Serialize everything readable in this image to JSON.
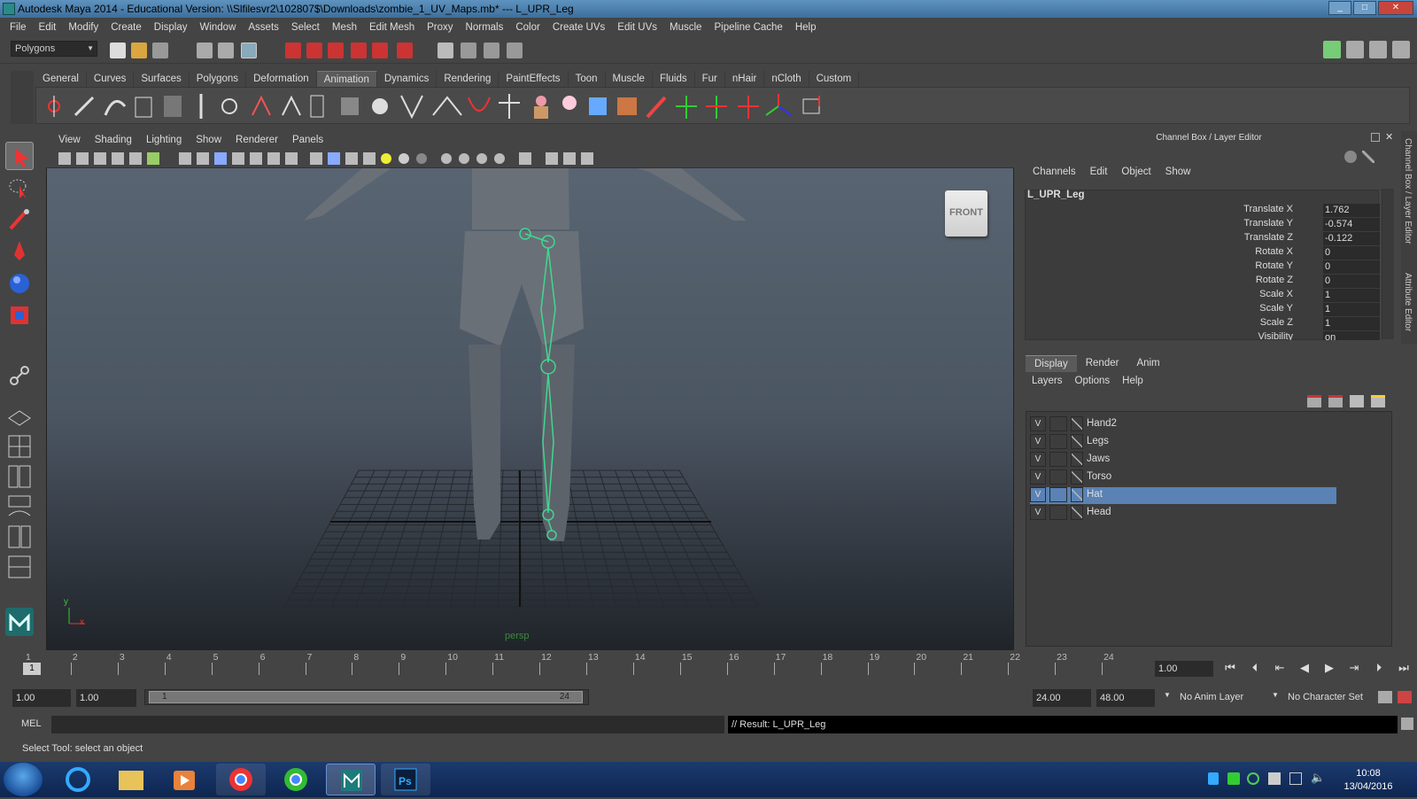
{
  "window": {
    "title": "Autodesk Maya 2014 - Educational Version: \\\\Slfilesvr2\\102807$\\Downloads\\zombie_1_UV_Maps.mb*   ---   L_UPR_Leg"
  },
  "menubar": [
    "File",
    "Edit",
    "Modify",
    "Create",
    "Display",
    "Window",
    "Assets",
    "Select",
    "Mesh",
    "Edit Mesh",
    "Proxy",
    "Normals",
    "Color",
    "Create UVs",
    "Edit UVs",
    "Muscle",
    "Pipeline Cache",
    "Help"
  ],
  "toolbar": {
    "mode": "Polygons"
  },
  "shelf": {
    "tabs": [
      "General",
      "Curves",
      "Surfaces",
      "Polygons",
      "Deformation",
      "Animation",
      "Dynamics",
      "Rendering",
      "PaintEffects",
      "Toon",
      "Muscle",
      "Fluids",
      "Fur",
      "nHair",
      "nCloth",
      "Custom"
    ],
    "active": "Animation"
  },
  "viewport": {
    "menu": [
      "View",
      "Shading",
      "Lighting",
      "Show",
      "Renderer",
      "Panels"
    ],
    "view_cube": "FRONT",
    "camera": "persp",
    "axis_y": "y",
    "axis_x": "x"
  },
  "channelbox": {
    "header": "Channel Box / Layer Editor",
    "menu": [
      "Channels",
      "Edit",
      "Object",
      "Show"
    ],
    "object": "L_UPR_Leg",
    "channels": [
      {
        "label": "Translate X",
        "value": "1.762"
      },
      {
        "label": "Translate Y",
        "value": "-0.574"
      },
      {
        "label": "Translate Z",
        "value": "-0.122"
      },
      {
        "label": "Rotate X",
        "value": "0"
      },
      {
        "label": "Rotate Y",
        "value": "0"
      },
      {
        "label": "Rotate Z",
        "value": "0"
      },
      {
        "label": "Scale X",
        "value": "1"
      },
      {
        "label": "Scale Y",
        "value": "1"
      },
      {
        "label": "Scale Z",
        "value": "1"
      },
      {
        "label": "Visibility",
        "value": "on"
      }
    ]
  },
  "sidetabs": {
    "channel": "Channel Box / Layer Editor",
    "attribute": "Attribute Editor"
  },
  "layer_editor": {
    "tabs": [
      "Display",
      "Render",
      "Anim"
    ],
    "active_tab": "Display",
    "menu": [
      "Layers",
      "Options",
      "Help"
    ],
    "layers": [
      {
        "v": "V",
        "name": "Hand2",
        "selected": false
      },
      {
        "v": "V",
        "name": "Legs",
        "selected": false
      },
      {
        "v": "V",
        "name": "Jaws",
        "selected": false
      },
      {
        "v": "V",
        "name": "Torso",
        "selected": false
      },
      {
        "v": "V",
        "name": "Hat",
        "selected": true
      },
      {
        "v": "V",
        "name": "Head",
        "selected": false
      }
    ]
  },
  "timeline": {
    "frames": [
      "1",
      "2",
      "3",
      "4",
      "5",
      "6",
      "7",
      "8",
      "9",
      "10",
      "11",
      "12",
      "13",
      "14",
      "15",
      "16",
      "17",
      "18",
      "19",
      "20",
      "21",
      "22",
      "23",
      "24"
    ],
    "current_marker": "1",
    "current_frame": "1.00"
  },
  "range": {
    "start": "1.00",
    "playback_start": "1.00",
    "slider_start": "1",
    "slider_end": "24",
    "playback_end": "24.00",
    "end": "48.00",
    "anim_layer": "No Anim Layer",
    "char_set": "No Character Set"
  },
  "command": {
    "label": "MEL",
    "result": "// Result: L_UPR_Leg"
  },
  "help_line": "Select Tool: select an object",
  "taskbar": {
    "time": "10:08",
    "date": "13/04/2016"
  },
  "colors": {
    "selection": "#5a82b4",
    "joint": "#3fd890",
    "grid": "#2a2e33"
  }
}
